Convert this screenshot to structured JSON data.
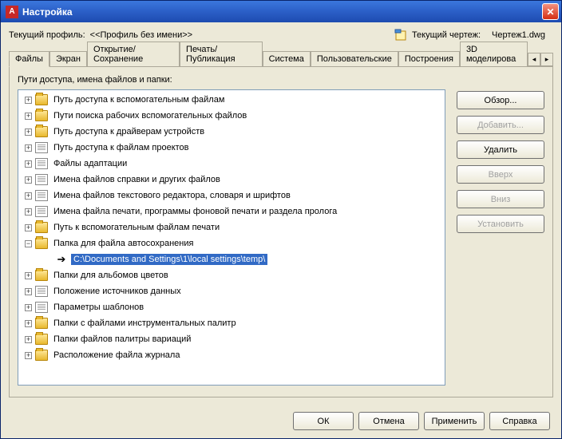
{
  "titlebar": {
    "title": "Настройка"
  },
  "profile": {
    "label": "Текущий профиль:",
    "value": "<<Профиль без имени>>",
    "drawing_label": "Текущий чертеж:",
    "drawing_value": "Чертеж1.dwg"
  },
  "tabs": [
    "Файлы",
    "Экран",
    "Открытие/Сохранение",
    "Печать/Публикация",
    "Система",
    "Пользовательские",
    "Построения",
    "3D моделирова"
  ],
  "tree": {
    "heading": "Пути доступа, имена файлов и папки:",
    "items": [
      {
        "icon": "folder",
        "label": "Путь доступа к вспомогательным файлам",
        "exp": "+"
      },
      {
        "icon": "folder",
        "label": "Пути поиска рабочих вспомогательных файлов",
        "exp": "+"
      },
      {
        "icon": "folder",
        "label": "Путь доступа к драйверам устройств",
        "exp": "+"
      },
      {
        "icon": "doc",
        "label": "Путь доступа к файлам проектов",
        "exp": "+"
      },
      {
        "icon": "doc",
        "label": "Файлы адаптации",
        "exp": "+"
      },
      {
        "icon": "doc",
        "label": "Имена файлов справки и других файлов",
        "exp": "+"
      },
      {
        "icon": "doc",
        "label": "Имена файлов текстового редактора, словаря и шрифтов",
        "exp": "+"
      },
      {
        "icon": "doc",
        "label": "Имена файла печати, программы фоновой печати и раздела пролога",
        "exp": "+"
      },
      {
        "icon": "folder",
        "label": "Путь к вспомогательным файлам печати",
        "exp": "+"
      },
      {
        "icon": "folder",
        "label": "Папка для файла автосохранения",
        "exp": "-",
        "children": [
          {
            "label": "C:\\Documents and Settings\\1\\local settings\\temp\\",
            "selected": true
          }
        ]
      },
      {
        "icon": "folder",
        "label": "Папки для альбомов цветов",
        "exp": "+"
      },
      {
        "icon": "doc",
        "label": "Положение источников данных",
        "exp": "+"
      },
      {
        "icon": "doc",
        "label": "Параметры шаблонов",
        "exp": "+"
      },
      {
        "icon": "folder",
        "label": "Папки с файлами инструментальных палитр",
        "exp": "+"
      },
      {
        "icon": "folder",
        "label": "Папки файлов палитры вариаций",
        "exp": "+"
      },
      {
        "icon": "folder",
        "label": "Расположение файла журнала",
        "exp": "+"
      }
    ]
  },
  "side": {
    "browse": "Обзор...",
    "add": "Добавить...",
    "delete": "Удалить",
    "up": "Вверх",
    "down": "Вниз",
    "set": "Установить"
  },
  "bottom": {
    "ok": "ОК",
    "cancel": "Отмена",
    "apply": "Применить",
    "help": "Справка"
  }
}
